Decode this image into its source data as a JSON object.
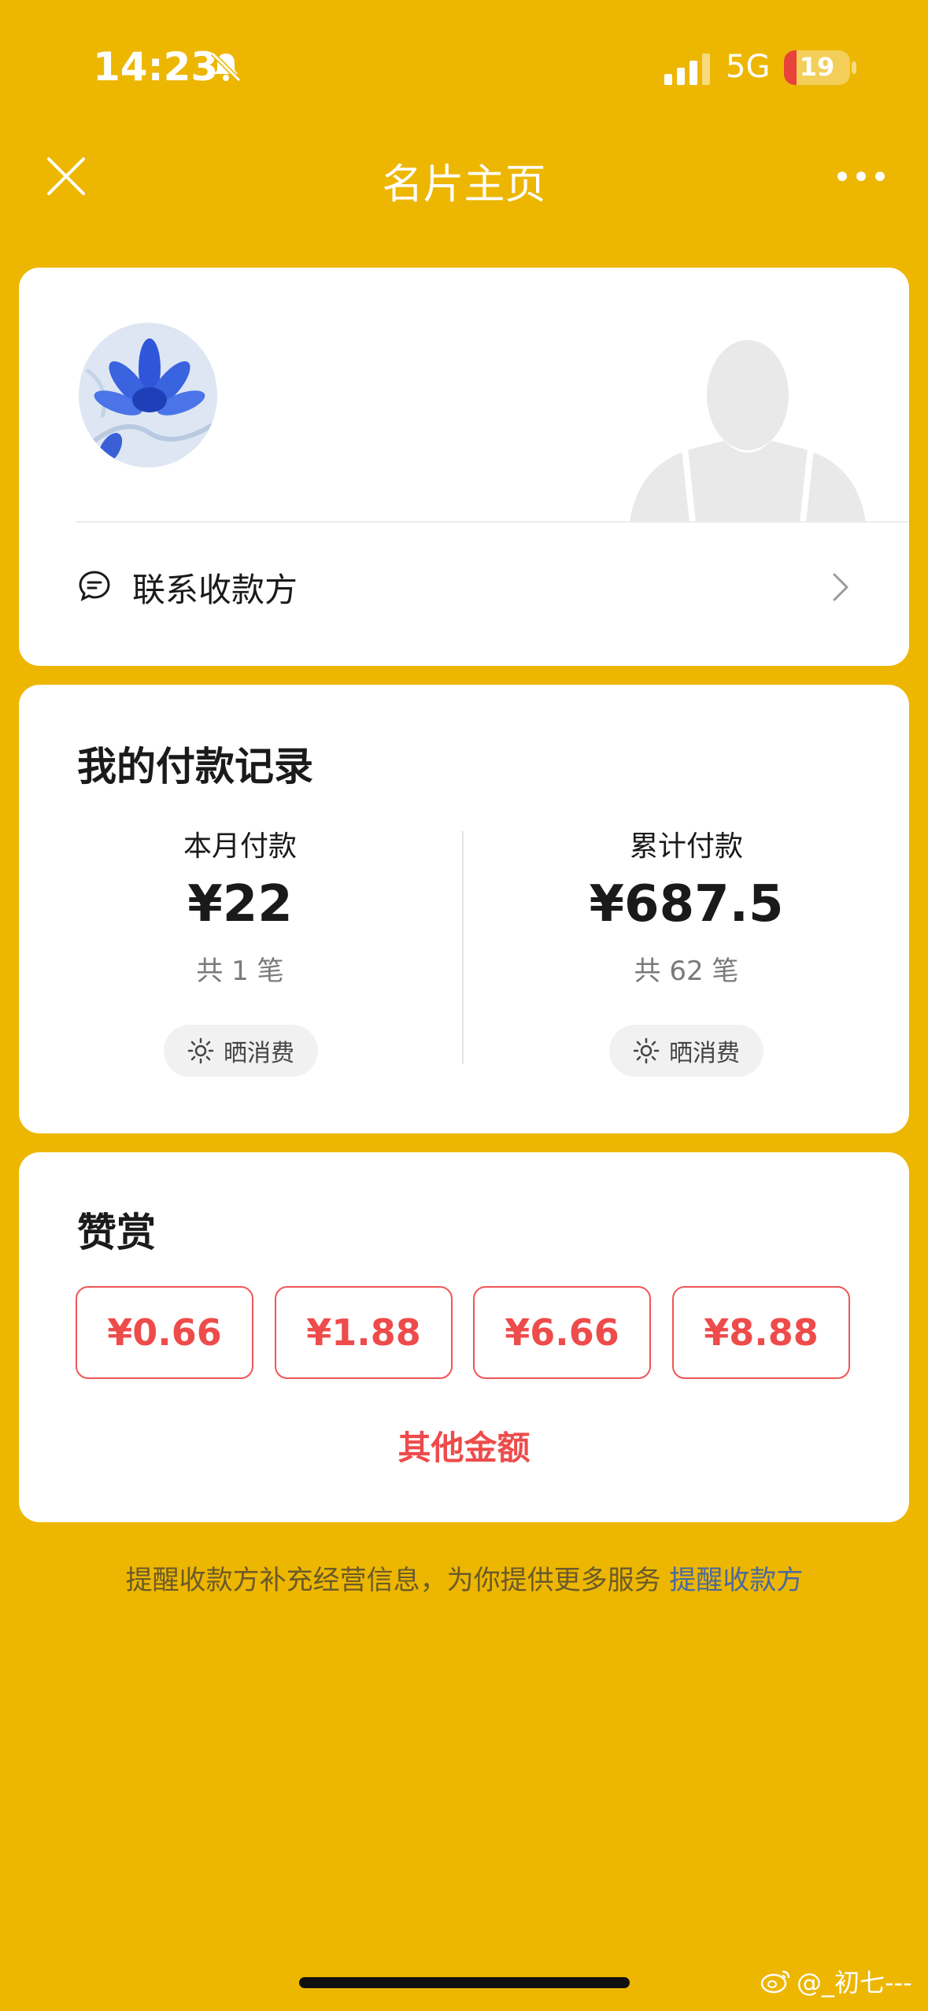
{
  "status_bar": {
    "time": "14:23",
    "network": "5G",
    "battery": "19",
    "battery_level": 0.19
  },
  "nav": {
    "title": "名片主页",
    "close_icon": "close-icon",
    "more_icon": "more-icon"
  },
  "profile": {
    "contact_label": "联系收款方"
  },
  "records": {
    "title": "我的付款记录",
    "month": {
      "label": "本月付款",
      "amount": "¥22",
      "count": "共 1 笔",
      "share_label": "晒消费"
    },
    "total": {
      "label": "累计付款",
      "amount": "¥687.5",
      "count": "共 62 笔",
      "share_label": "晒消费"
    }
  },
  "reward": {
    "title": "赞赏",
    "amounts": [
      "¥0.66",
      "¥1.88",
      "¥6.66",
      "¥8.88"
    ],
    "other_label": "其他金额"
  },
  "notice": {
    "text": "提醒收款方补充经营信息，为你提供更多服务 ",
    "link": "提醒收款方"
  },
  "watermark": {
    "text": "@_初七---"
  },
  "colors": {
    "background": "#EDB600",
    "accent_red": "#EE4B4B",
    "link": "#4A6A9E"
  }
}
